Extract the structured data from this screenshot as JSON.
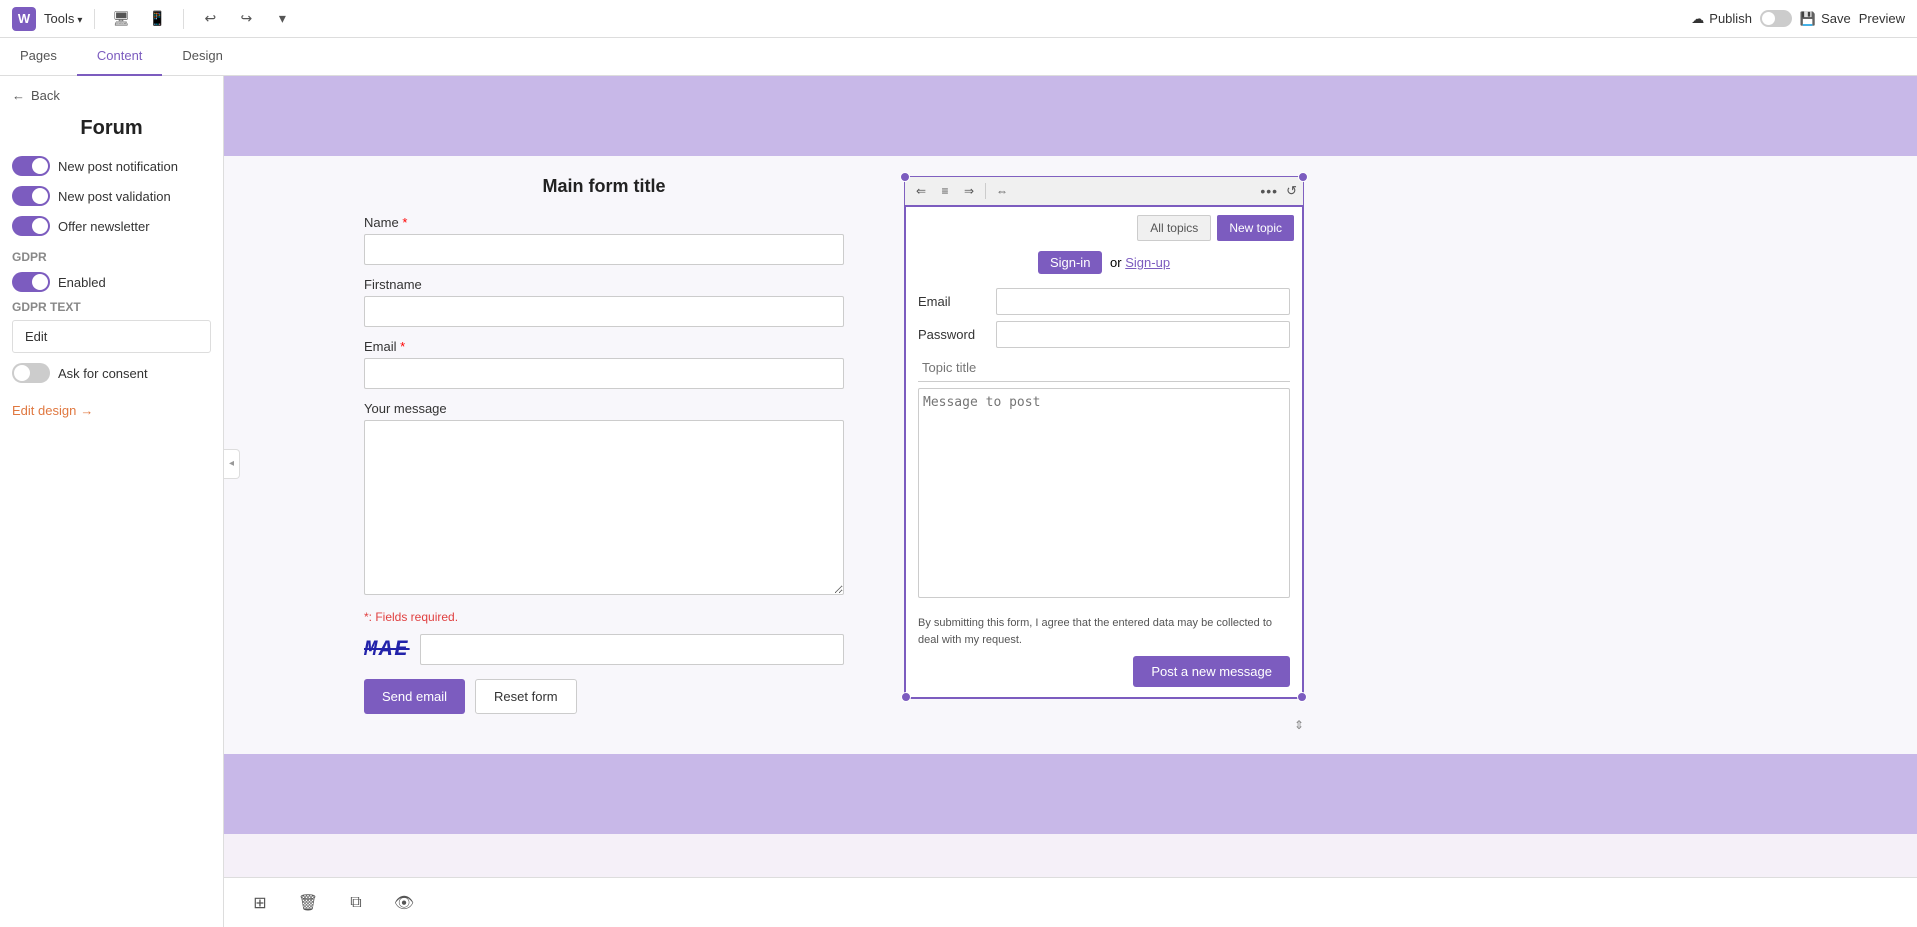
{
  "topbar": {
    "logo": "W",
    "tools_label": "Tools",
    "publish_label": "Publish",
    "save_label": "Save",
    "preview_label": "Preview"
  },
  "subtabs": {
    "tabs": [
      {
        "id": "pages",
        "label": "Pages"
      },
      {
        "id": "content",
        "label": "Content",
        "active": true
      },
      {
        "id": "design",
        "label": "Design"
      }
    ]
  },
  "sidebar": {
    "back_label": "Back",
    "title": "Forum",
    "toggles": [
      {
        "label": "New post notification",
        "on": true
      },
      {
        "label": "New post validation",
        "on": true
      },
      {
        "label": "Offer newsletter",
        "on": true
      }
    ],
    "gdpr_section": "GDPR",
    "gdpr_enabled_label": "Enabled",
    "gdpr_text_section": "GDPR Text",
    "edit_btn_label": "Edit",
    "ask_consent_label": "Ask for consent",
    "edit_design_label": "Edit design",
    "edit_design_arrow": "→"
  },
  "form": {
    "title": "Main form title",
    "name_label": "Name",
    "firstname_label": "Firstname",
    "email_label": "Email",
    "message_label": "Your message",
    "required_text": "*: Fields required.",
    "captcha_text": "MAE",
    "captcha_placeholder": "",
    "send_btn": "Send email",
    "reset_btn": "Reset form"
  },
  "forum_widget": {
    "all_topics_btn": "All topics",
    "new_topic_btn": "New topic",
    "signin_btn": "Sign-in",
    "or_text": "or",
    "signup_link": "Sign-up",
    "email_label": "Email",
    "password_label": "Password",
    "topic_title_placeholder": "Topic title",
    "message_placeholder": "Message to post",
    "consent_text": "By submitting this form, I agree that the entered data may be collected to deal with my request.",
    "post_btn": "Post a new message",
    "menu_dots": "•••",
    "refresh_icon": "↺",
    "tb_icons": [
      "⇐",
      "≡",
      "⇒",
      "⇔"
    ]
  },
  "bottom_toolbar": {
    "icons": [
      "add-section",
      "delete",
      "layers",
      "visibility"
    ]
  }
}
